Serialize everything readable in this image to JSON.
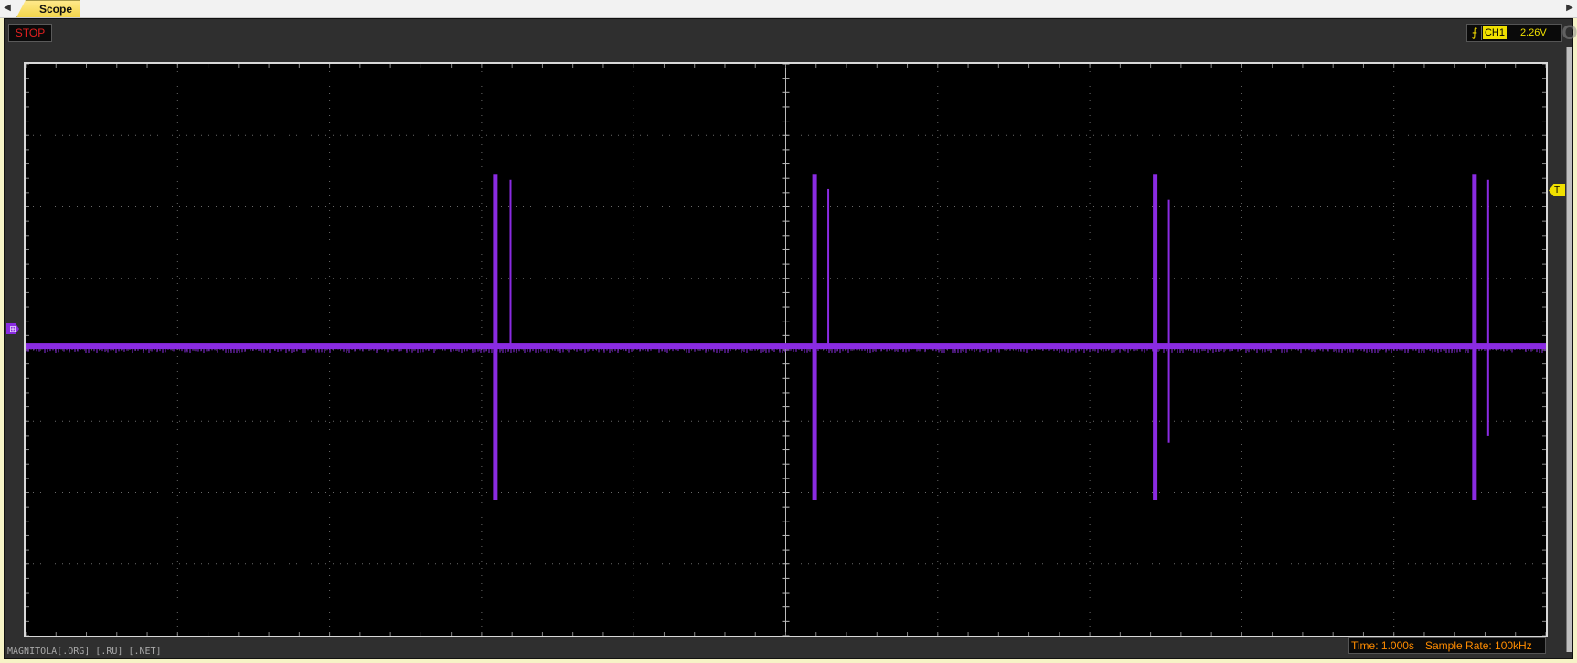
{
  "tab": {
    "label": "Scope"
  },
  "nav": {
    "left": "◀",
    "right": "▶"
  },
  "controls": {
    "stop_label": "STOP"
  },
  "trigger": {
    "edge_glyph": "⨍",
    "channel": "CH1",
    "level": "2.26V",
    "marker_label": "T",
    "icon": "rising-edge-icon"
  },
  "channel_marker": {
    "label": "⊞"
  },
  "logo": {
    "text": "MAGNITOLA"
  },
  "status": {
    "time": "Time: 1.000s",
    "sample_rate": "Sample Rate: 100kHz"
  },
  "watermark": "MAGNITOLA[.ORG] [.RU] [.NET]",
  "colors": {
    "trace": "#8a2be2",
    "grid": "#6a6a6a",
    "status_text": "#ff8c00",
    "stop_text": "#e02020",
    "trigger": "#f0e000"
  },
  "chart_data": {
    "type": "line",
    "divisions": {
      "x": 10,
      "y": 8
    },
    "baseline_div": 3.95,
    "series": [
      {
        "pulses": [
          {
            "x_div": 3.09,
            "top_div": 1.55,
            "bottom_div": 6.1
          },
          {
            "x_div": 3.19,
            "top_div": 1.62,
            "bottom_div": 3.95
          },
          {
            "x_div": 5.19,
            "top_div": 1.55,
            "bottom_div": 6.1
          },
          {
            "x_div": 5.28,
            "top_div": 1.75,
            "bottom_div": 3.95
          },
          {
            "x_div": 7.43,
            "top_div": 1.55,
            "bottom_div": 6.1
          },
          {
            "x_div": 7.52,
            "top_div": 1.9,
            "bottom_div": 5.3
          },
          {
            "x_div": 9.53,
            "top_div": 1.55,
            "bottom_div": 6.1
          },
          {
            "x_div": 9.62,
            "top_div": 1.62,
            "bottom_div": 5.2
          }
        ]
      }
    ]
  }
}
